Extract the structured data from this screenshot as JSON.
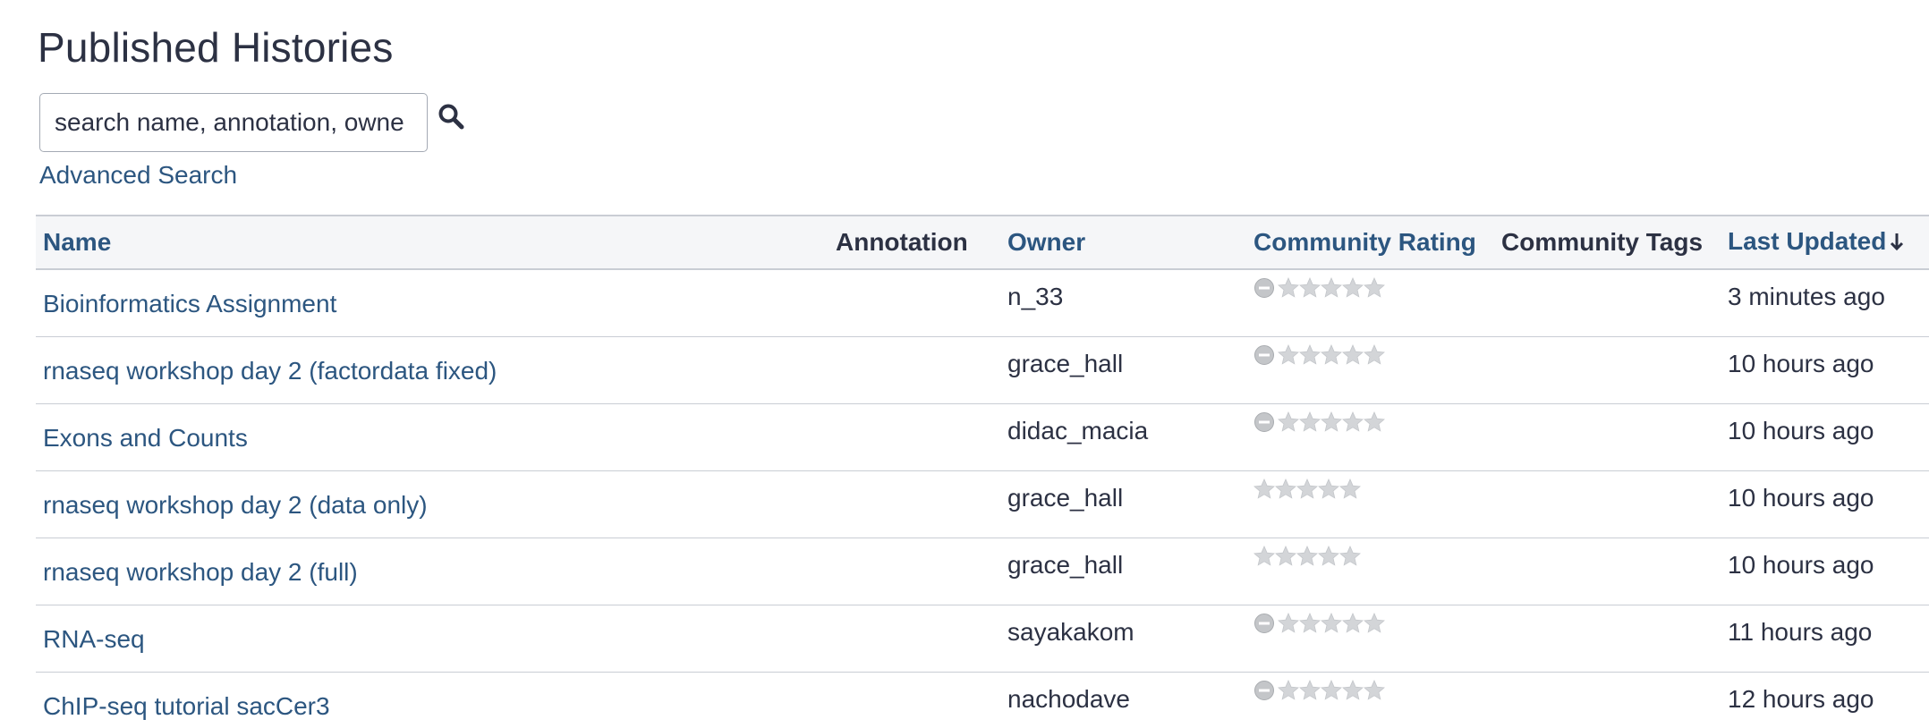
{
  "page_title": "Published Histories",
  "search": {
    "placeholder": "search name, annotation, owne",
    "icon": "search-icon"
  },
  "advanced_search_label": "Advanced Search",
  "table": {
    "columns": {
      "name": "Name",
      "annotation": "Annotation",
      "owner": "Owner",
      "rating": "Community Rating",
      "tags": "Community Tags",
      "updated": "Last Updated"
    },
    "sort": {
      "column": "updated",
      "direction": "descending",
      "icon": "sort-arrow-down-icon"
    },
    "rows": [
      {
        "name": "Bioinformatics Assignment",
        "annotation": "",
        "owner": "n_33",
        "rating": 0,
        "rating_cancel_shown": true,
        "tags": "",
        "updated": "3 minutes ago"
      },
      {
        "name": "rnaseq workshop day 2 (factordata fixed)",
        "annotation": "",
        "owner": "grace_hall",
        "rating": 0,
        "rating_cancel_shown": true,
        "tags": "",
        "updated": "10 hours ago"
      },
      {
        "name": "Exons and Counts",
        "annotation": "",
        "owner": "didac_macia",
        "rating": 0,
        "rating_cancel_shown": true,
        "tags": "",
        "updated": "10 hours ago"
      },
      {
        "name": "rnaseq workshop day 2 (data only)",
        "annotation": "",
        "owner": "grace_hall",
        "rating": 0,
        "rating_cancel_shown": false,
        "tags": "",
        "updated": "10 hours ago"
      },
      {
        "name": "rnaseq workshop day 2 (full)",
        "annotation": "",
        "owner": "grace_hall",
        "rating": 0,
        "rating_cancel_shown": false,
        "tags": "",
        "updated": "10 hours ago"
      },
      {
        "name": "RNA-seq",
        "annotation": "",
        "owner": "sayakakom",
        "rating": 0,
        "rating_cancel_shown": true,
        "tags": "",
        "updated": "11 hours ago"
      },
      {
        "name": "ChIP-seq tutorial sacCer3",
        "annotation": "",
        "owner": "nachodave",
        "rating": 0,
        "rating_cancel_shown": true,
        "tags": "",
        "updated": "12 hours ago"
      }
    ]
  },
  "colors": {
    "link": "#2c5680",
    "text": "#2c3143",
    "header_bg": "#f5f6f8",
    "border": "#c9cdd4",
    "star_empty": "#d3d5d8"
  }
}
